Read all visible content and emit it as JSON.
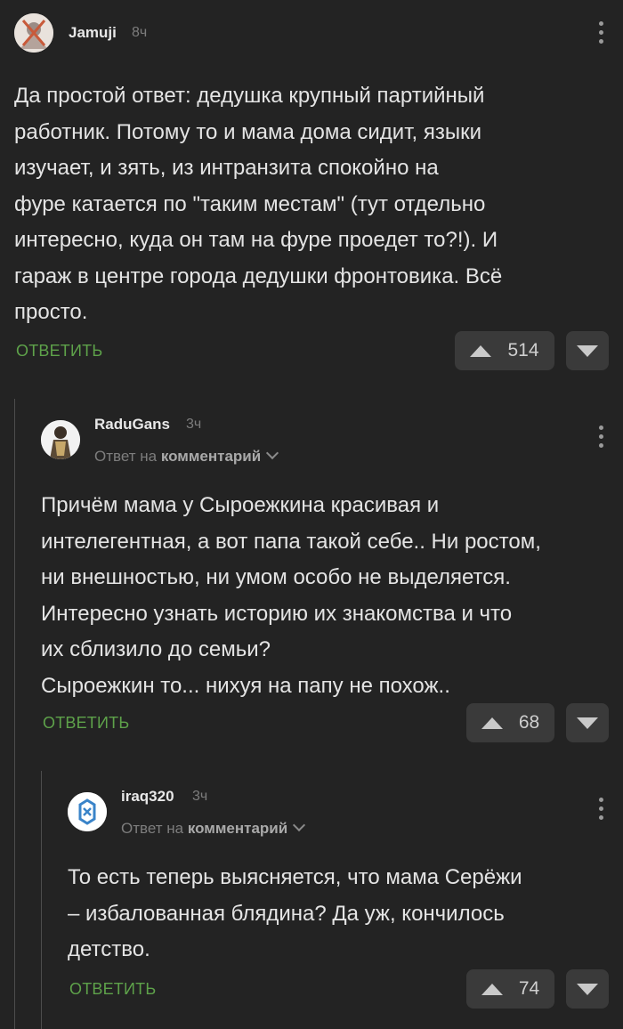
{
  "comments": [
    {
      "author": "Jamuji",
      "time": "8ч",
      "text": "Да простой ответ: дедушка крупный партийный\nработник. Потому то и мама дома сидит, языки\nизучает, и зять, из интранзита спокойно на\nфуре катается по \"таким местам\" (тут отдельно\nинтересно, куда он там на фуре проедет то?!). И\nгараж в центре города дедушки фронтовика. Всё\nпросто.",
      "reply_label": "ОТВЕТИТЬ",
      "votes": "514"
    },
    {
      "author": "RaduGans",
      "time": "3ч",
      "reply_prefix": "Ответ на",
      "reply_target": "комментарий",
      "text": "Причём мама у Сыроежкина красивая и\nинтелегентная, а вот папа такой себе.. Ни ростом,\nни внешностью, ни умом особо не выделяется.\nИнтересно узнать историю их знакомства и что\nих сблизило до семьи?\nСыроежкин то... нихуя на папу не похож..",
      "reply_label": "ОТВЕТИТЬ",
      "votes": "68"
    },
    {
      "author": "iraq320",
      "time": "3ч",
      "reply_prefix": "Ответ на",
      "reply_target": "комментарий",
      "text": "То есть теперь выясняется, что мама Серёжи\n– избалованная блядина? Да уж, кончилось\nдетство.",
      "reply_label": "ОТВЕТИТЬ",
      "votes": "74"
    }
  ]
}
